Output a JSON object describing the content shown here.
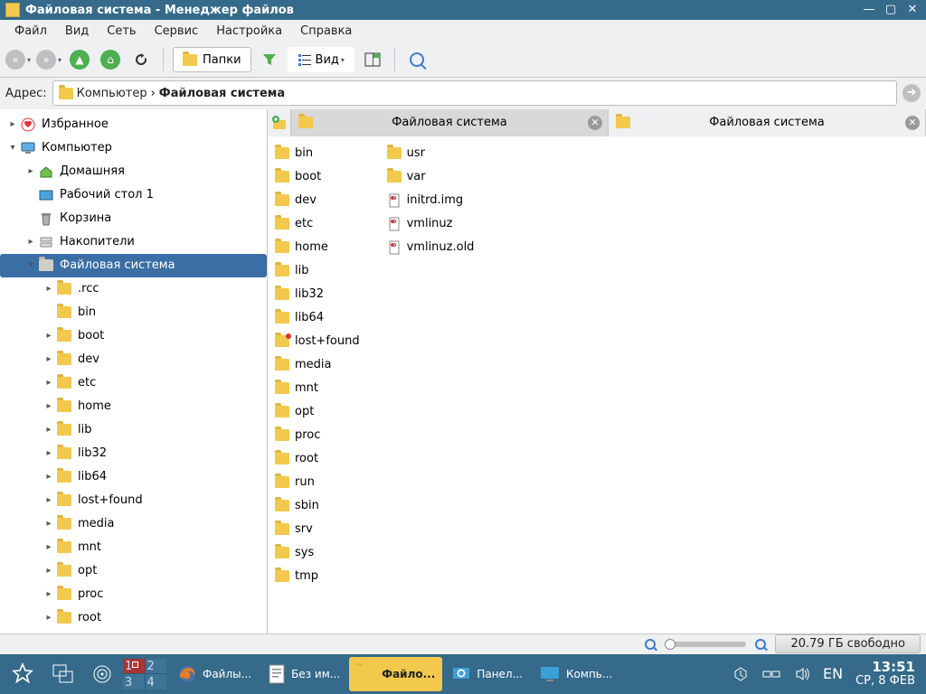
{
  "window": {
    "title": "Файловая система - Менеджер файлов"
  },
  "menu": [
    "Файл",
    "Вид",
    "Сеть",
    "Сервис",
    "Настройка",
    "Справка"
  ],
  "toolbar": {
    "folders_label": "Папки",
    "view_label": "Вид"
  },
  "address": {
    "label": "Адрес:",
    "segments": [
      {
        "text": "Компьютер",
        "bold": false
      },
      {
        "text": "Файловая система",
        "bold": true
      }
    ]
  },
  "sidebar": {
    "items": [
      {
        "level": 0,
        "twisty": ">",
        "icon": "fav",
        "label": "Избранное"
      },
      {
        "level": 0,
        "twisty": "v",
        "icon": "monitor",
        "label": "Компьютер"
      },
      {
        "level": 1,
        "twisty": ">",
        "icon": "home",
        "label": "Домашняя"
      },
      {
        "level": 1,
        "twisty": "",
        "icon": "desktop",
        "label": "Рабочий стол 1"
      },
      {
        "level": 1,
        "twisty": "",
        "icon": "trash",
        "label": "Корзина"
      },
      {
        "level": 1,
        "twisty": ">",
        "icon": "drives",
        "label": "Накопители"
      },
      {
        "level": 1,
        "twisty": "v",
        "icon": "fold-g",
        "label": "Файловая система",
        "selected": true
      },
      {
        "level": 2,
        "twisty": ">",
        "icon": "fold",
        "label": ".rcc"
      },
      {
        "level": 2,
        "twisty": "",
        "icon": "fold",
        "label": "bin"
      },
      {
        "level": 2,
        "twisty": ">",
        "icon": "fold",
        "label": "boot"
      },
      {
        "level": 2,
        "twisty": ">",
        "icon": "fold",
        "label": "dev"
      },
      {
        "level": 2,
        "twisty": ">",
        "icon": "fold",
        "label": "etc"
      },
      {
        "level": 2,
        "twisty": ">",
        "icon": "fold",
        "label": "home"
      },
      {
        "level": 2,
        "twisty": ">",
        "icon": "fold",
        "label": "lib"
      },
      {
        "level": 2,
        "twisty": ">",
        "icon": "fold",
        "label": "lib32"
      },
      {
        "level": 2,
        "twisty": ">",
        "icon": "fold",
        "label": "lib64"
      },
      {
        "level": 2,
        "twisty": ">",
        "icon": "fold",
        "label": "lost+found"
      },
      {
        "level": 2,
        "twisty": ">",
        "icon": "fold",
        "label": "media"
      },
      {
        "level": 2,
        "twisty": ">",
        "icon": "fold",
        "label": "mnt"
      },
      {
        "level": 2,
        "twisty": ">",
        "icon": "fold",
        "label": "opt"
      },
      {
        "level": 2,
        "twisty": ">",
        "icon": "fold",
        "label": "proc"
      },
      {
        "level": 2,
        "twisty": ">",
        "icon": "fold",
        "label": "root"
      }
    ]
  },
  "tabs": [
    {
      "label": "Файловая система",
      "active": true
    },
    {
      "label": "Файловая система",
      "active": false
    }
  ],
  "files": {
    "col1": [
      {
        "t": "fold",
        "n": "bin"
      },
      {
        "t": "fold",
        "n": "boot"
      },
      {
        "t": "fold",
        "n": "dev"
      },
      {
        "t": "fold",
        "n": "etc"
      },
      {
        "t": "fold",
        "n": "home"
      },
      {
        "t": "fold",
        "n": "lib"
      },
      {
        "t": "fold",
        "n": "lib32"
      },
      {
        "t": "fold",
        "n": "lib64"
      },
      {
        "t": "fold-l",
        "n": "lost+found"
      },
      {
        "t": "fold",
        "n": "media"
      },
      {
        "t": "fold",
        "n": "mnt"
      },
      {
        "t": "fold",
        "n": "opt"
      },
      {
        "t": "fold",
        "n": "proc"
      },
      {
        "t": "fold",
        "n": "root"
      },
      {
        "t": "fold",
        "n": "run"
      },
      {
        "t": "fold",
        "n": "sbin"
      },
      {
        "t": "fold",
        "n": "srv"
      },
      {
        "t": "fold",
        "n": "sys"
      },
      {
        "t": "fold",
        "n": "tmp"
      }
    ],
    "col2": [
      {
        "t": "fold",
        "n": "usr"
      },
      {
        "t": "fold",
        "n": "var"
      },
      {
        "t": "file",
        "n": "initrd.img"
      },
      {
        "t": "file",
        "n": "vmlinuz"
      },
      {
        "t": "file",
        "n": "vmlinuz.old"
      }
    ]
  },
  "status": {
    "free": "20.79 ГБ свободно"
  },
  "taskbar": {
    "apps": [
      {
        "icon": "firefox",
        "label": "Файлы...",
        "active": false
      },
      {
        "icon": "doc",
        "label": "Без им...",
        "active": false
      },
      {
        "icon": "folder",
        "label": "Файло...",
        "active": true
      },
      {
        "icon": "gear",
        "label": "Панел...",
        "active": false
      },
      {
        "icon": "monitor",
        "label": "Компь...",
        "active": false
      }
    ],
    "pager": [
      "1",
      "2",
      "3",
      "4"
    ],
    "lang": "EN",
    "clock": {
      "time": "13:51",
      "date": "СР, 8 ФЕВ"
    }
  }
}
